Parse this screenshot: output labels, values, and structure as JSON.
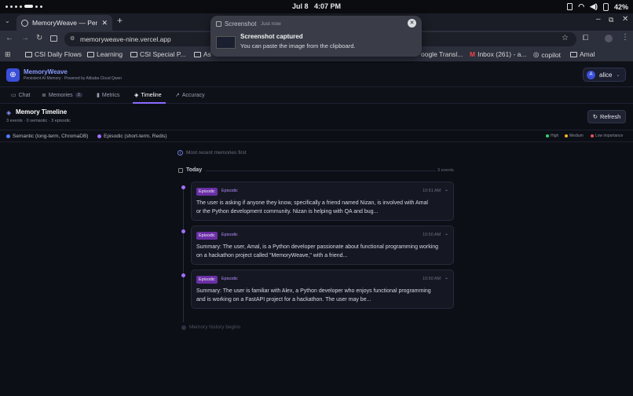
{
  "status_bar": {
    "date": "Jul 8",
    "time": "4:07 PM",
    "battery": "42%"
  },
  "browser": {
    "tab_title": "MemoryWeave — Pers...",
    "url": "memoryweave-nine.vercel.app",
    "bookmarks": [
      "CSI Daily Flows",
      "Learning",
      "CSI Special P...",
      "As",
      "oogle Transl...",
      "Inbox (261) - a...",
      "copilot",
      "Amal"
    ]
  },
  "toast": {
    "app": "Screenshot",
    "when": "Just now",
    "title": "Screenshot captured",
    "message": "You can paste the image from the clipboard."
  },
  "app": {
    "name": "MemoryWeave",
    "tagline": "Persistent AI Memory · Powered by Alibaba Cloud Qwen",
    "user_initial": "A",
    "user": "alice",
    "tabs": [
      {
        "label": "Chat"
      },
      {
        "label": "Memories",
        "count": "3"
      },
      {
        "label": "Metrics"
      },
      {
        "label": "Timeline"
      },
      {
        "label": "Accuracy"
      }
    ]
  },
  "timeline": {
    "title": "Memory Timeline",
    "summary": "3 events · 0 semantic · 3 episodic",
    "refresh_label": "Refresh",
    "legend": {
      "semantic": "Semantic (long-term, ChromaDB)",
      "episodic": "Episodic (short-term, Redis)",
      "high": "High",
      "medium": "Medium",
      "low": "Low importance"
    },
    "order_note": "Most recent memories first",
    "group_label": "Today",
    "group_count": "3 events",
    "events": [
      {
        "badge": "Episodic",
        "type": "Episodic",
        "time": "10:51 AM",
        "text": "The user is asking if anyone they know, specifically a friend named Nizan, is involved with Amal or the Python development community. Nizan is helping with QA and bug..."
      },
      {
        "badge": "Episodic",
        "type": "Episodic",
        "time": "10:50 AM",
        "text": "Summary: The user, Amal, is a Python developer passionate about functional programming working on a hackathon project called \"MemoryWeave,\" with a friend..."
      },
      {
        "badge": "Episodic",
        "type": "Episodic",
        "time": "10:50 AM",
        "text": "Summary: The user is familiar with Alex, a Python developer who enjoys functional programming and is working on a FastAPI project for a hackathon. The user may be..."
      }
    ],
    "end_note": "Memory history begins"
  },
  "colors": {
    "accent": "#3a4fd8",
    "episodic": "#a070ff",
    "semantic": "#4f7bff",
    "high": "#3ccf6e",
    "medium": "#f0b429",
    "low": "#f05252"
  }
}
